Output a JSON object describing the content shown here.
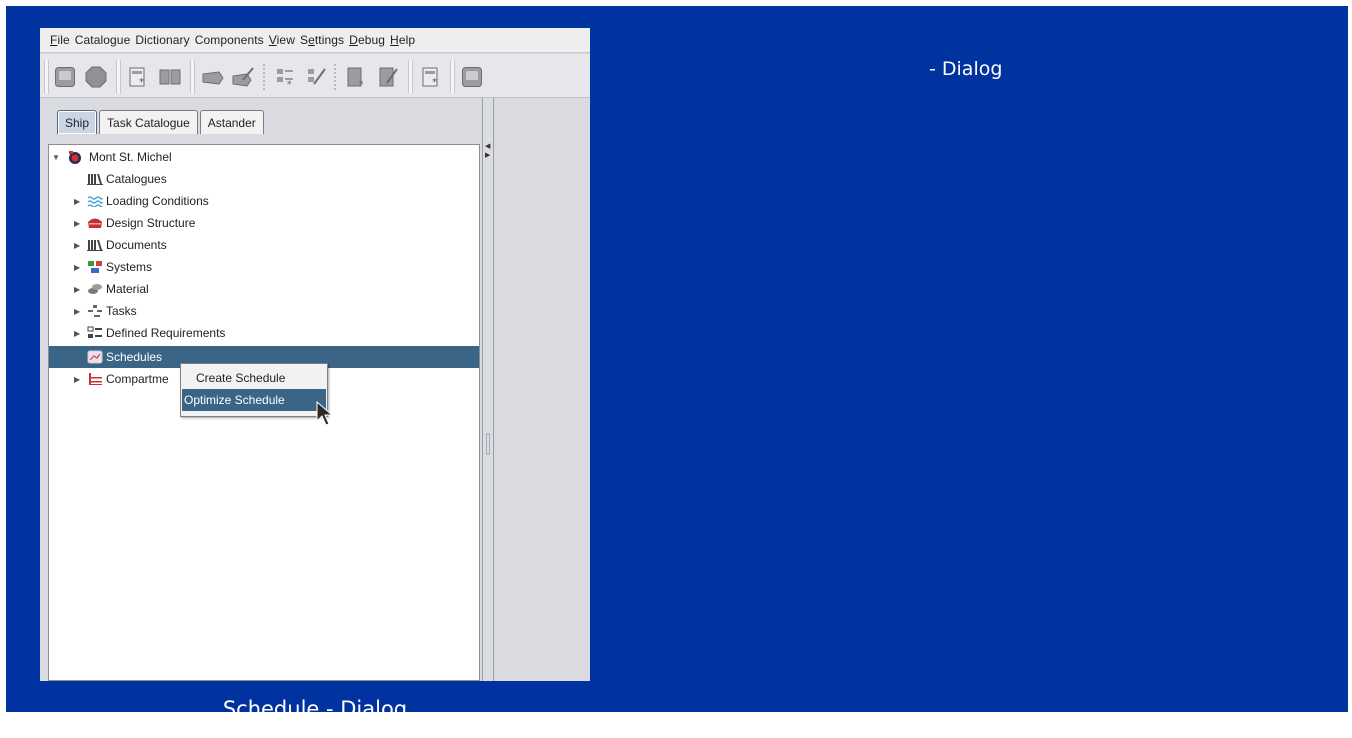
{
  "slide": {
    "right_title": "- Dialog",
    "caption": "Schedule - Dialog",
    "background_color": "#0033a0"
  },
  "menubar": {
    "items": [
      {
        "label": "File",
        "mnemonic": "F"
      },
      {
        "label": "Catalogue"
      },
      {
        "label": "Dictionary"
      },
      {
        "label": "Components"
      },
      {
        "label": "View",
        "mnemonic": "V"
      },
      {
        "label": "Settings",
        "mnemonic": "e"
      },
      {
        "label": "Debug",
        "mnemonic": "D"
      },
      {
        "label": "Help",
        "mnemonic": "H"
      }
    ]
  },
  "toolbar": {
    "buttons": [
      {
        "icon": "save-icon"
      },
      {
        "icon": "stop-icon"
      },
      {
        "icon": "new-catalogue-icon"
      },
      {
        "icon": "open-book-icon"
      },
      {
        "icon": "move-icon"
      },
      {
        "icon": "edit-icon"
      },
      {
        "icon": "new-list-icon"
      },
      {
        "icon": "edit-list-icon"
      },
      {
        "icon": "new-document-icon"
      },
      {
        "icon": "edit-document-icon"
      },
      {
        "icon": "new-catalogue-icon"
      },
      {
        "icon": "save-icon"
      }
    ]
  },
  "tabs": [
    {
      "label": "Ship",
      "active": true
    },
    {
      "label": "Task Catalogue",
      "active": false
    },
    {
      "label": "Astander",
      "active": false
    }
  ],
  "tree": {
    "root": {
      "label": "Mont St. Michel",
      "icon": "ship-icon",
      "expanded": true
    },
    "items": [
      {
        "label": "Catalogues",
        "icon": "library-icon",
        "expandable": false
      },
      {
        "label": "Loading Conditions",
        "icon": "waves-icon",
        "expandable": true
      },
      {
        "label": "Design Structure",
        "icon": "hull-icon",
        "expandable": true
      },
      {
        "label": "Documents",
        "icon": "library-icon",
        "expandable": true
      },
      {
        "label": "Systems",
        "icon": "systems-icon",
        "expandable": true
      },
      {
        "label": "Material",
        "icon": "material-icon",
        "expandable": true
      },
      {
        "label": "Tasks",
        "icon": "tasks-icon",
        "expandable": true
      },
      {
        "label": "Defined Requirements",
        "icon": "requirements-icon",
        "expandable": true
      },
      {
        "label": "Schedules",
        "icon": "schedule-icon",
        "expandable": false,
        "selected": true
      },
      {
        "label": "Compartme",
        "icon": "compartments-icon",
        "expandable": true
      }
    ]
  },
  "context_menu": {
    "items": [
      {
        "label": "Create Schedule",
        "highlighted": false
      },
      {
        "label": "Optimize Schedule",
        "highlighted": true
      }
    ]
  },
  "colors": {
    "selection": "#3b6587",
    "accent_blue": "#0033a0"
  }
}
